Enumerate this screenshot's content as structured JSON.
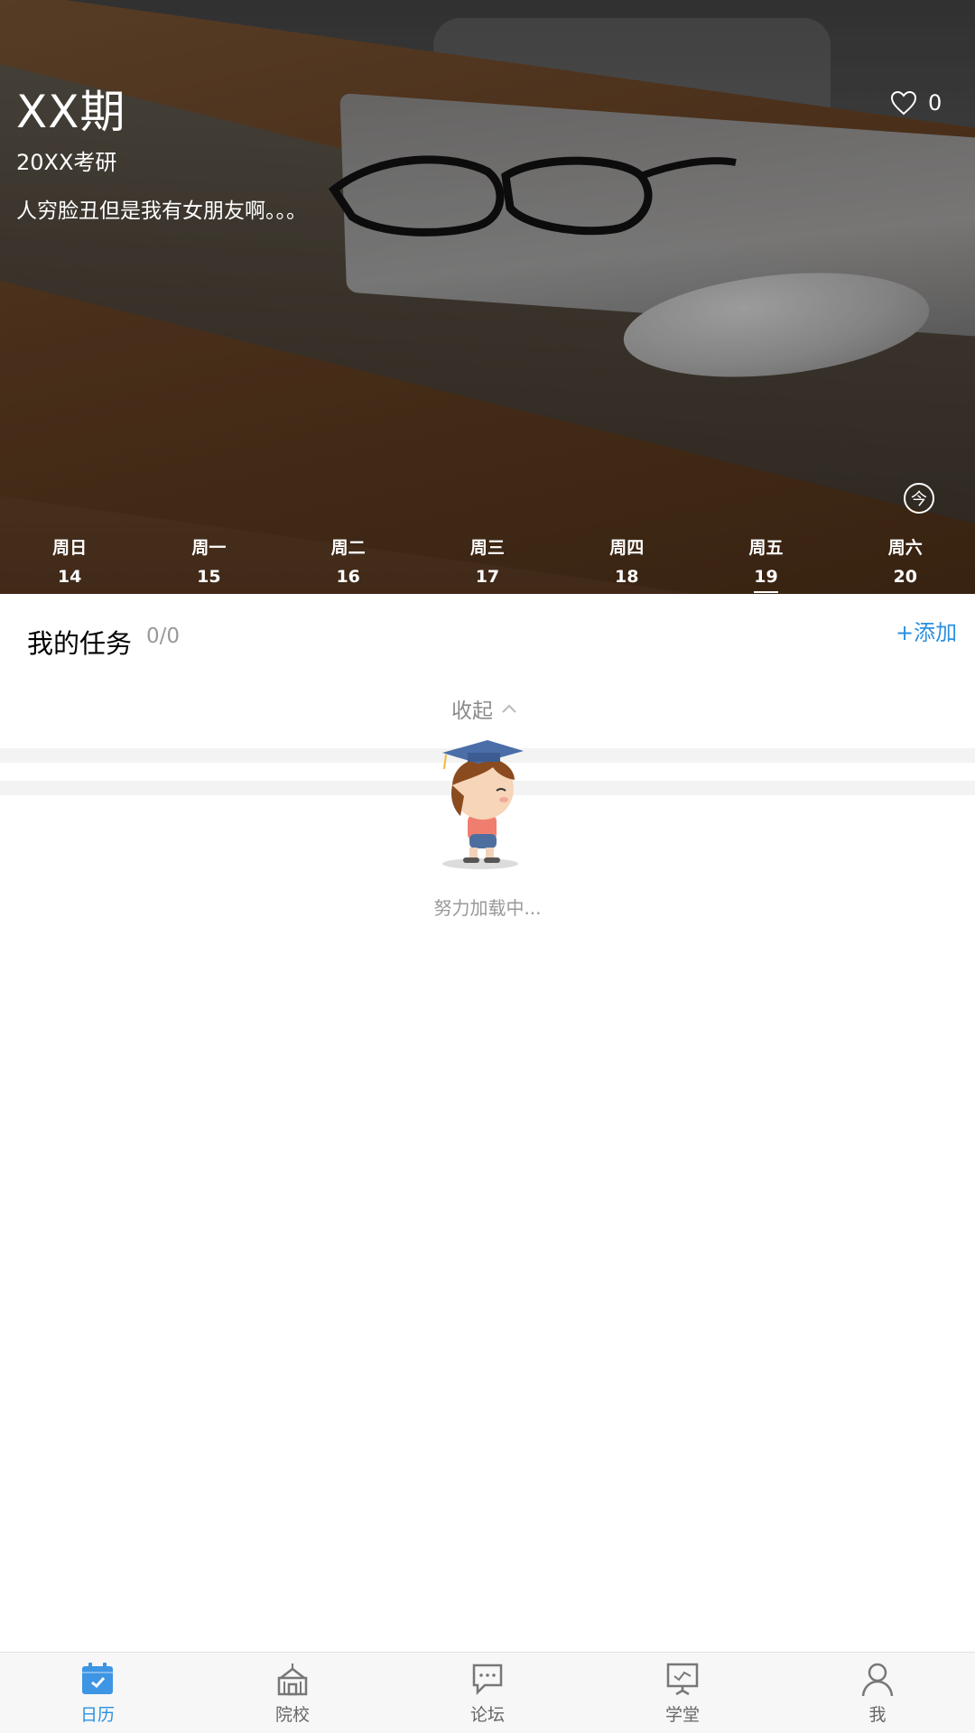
{
  "header": {
    "title": "XX期",
    "subtitle": "20XX考研",
    "motto": "人穷脸丑但是我有女朋友啊。。。",
    "like_count": "0",
    "today_label": "今"
  },
  "week": [
    {
      "name": "周日",
      "date": "14"
    },
    {
      "name": "周一",
      "date": "15"
    },
    {
      "name": "周二",
      "date": "16"
    },
    {
      "name": "周三",
      "date": "17"
    },
    {
      "name": "周四",
      "date": "18"
    },
    {
      "name": "周五",
      "date": "19"
    },
    {
      "name": "周六",
      "date": "20"
    }
  ],
  "selected_day_index": 5,
  "tasks": {
    "title": "我的任务",
    "count": "0/0",
    "add_label": "+添加",
    "collapse_label": "收起"
  },
  "loading": {
    "text": "努力加载中..."
  },
  "bottom_nav": [
    {
      "label": "日历",
      "icon": "calendar-icon"
    },
    {
      "label": "院校",
      "icon": "school-icon"
    },
    {
      "label": "论坛",
      "icon": "forum-icon"
    },
    {
      "label": "学堂",
      "icon": "classroom-icon"
    },
    {
      "label": "我",
      "icon": "profile-icon"
    }
  ],
  "colors": {
    "accent": "#2b90e0",
    "muted_text": "#999999"
  }
}
